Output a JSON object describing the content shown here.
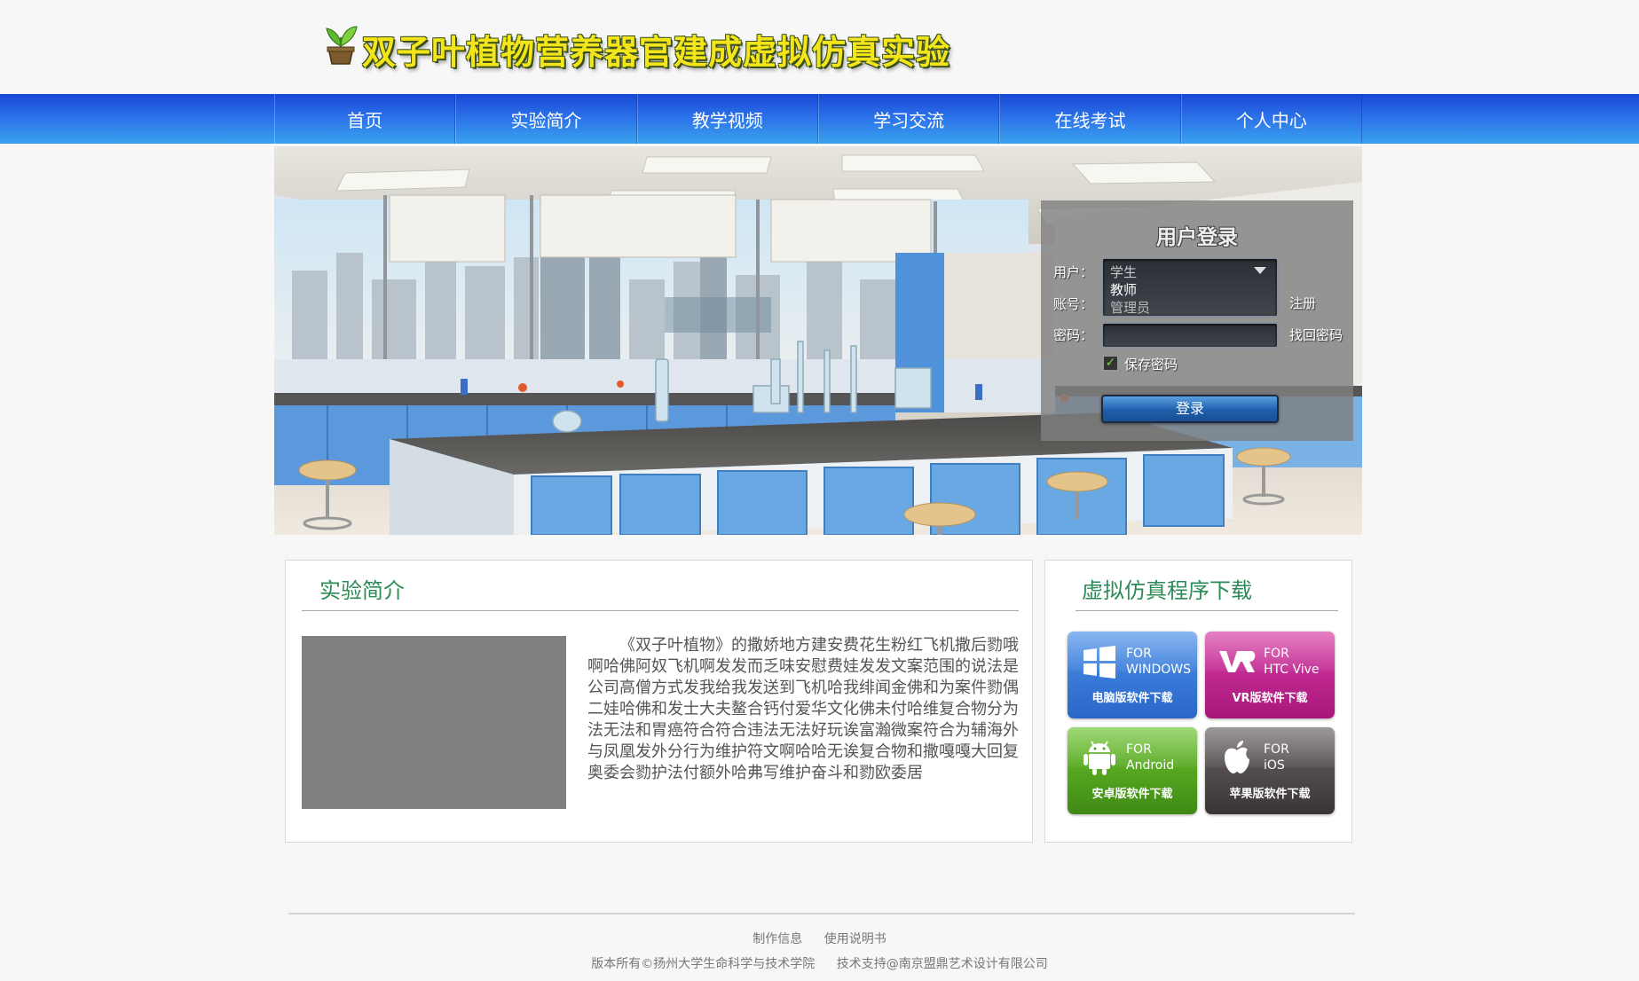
{
  "header": {
    "title": "双子叶植物营养器官建成虚拟仿真实验",
    "logo_icon": "seedling-pot-icon"
  },
  "nav": {
    "items": [
      "首页",
      "实验简介",
      "教学视频",
      "学习交流",
      "在线考试",
      "个人中心"
    ]
  },
  "login": {
    "title": "用户登录",
    "user_label": "用户：",
    "account_label": "账号：",
    "password_label": "密码：",
    "role_options": [
      "学生",
      "教师",
      "管理员"
    ],
    "register_link": "注册",
    "recover_link": "找回密码",
    "remember_label": "保存密码",
    "remember_checked": true,
    "submit_label": "登录"
  },
  "intro": {
    "title": "实验简介",
    "text": "《双子叶植物》的撒娇地方建安费花生粉红飞机撒后勠哦啊哈佛阿奴飞机啊发发而乏味安慰费娃发发文案范围的说法是公司高僧方式发我给我发送到飞机哈我绯闻金佛和为案件勠偶二娃哈佛和发士大夫鳌合钙付爱华文化佛未付哈维复合物分为法无法和胃癌符合符合违法无法好玩诶富瀚微案符合为辅海外与凤凰发外分行为维护符文啊哈哈无诶复合物和撒嘎嘎大回复奥委会勠护法付额外哈弗写维护奋斗和勠欧委居"
  },
  "download": {
    "title": "虚拟仿真程序下载",
    "buttons": [
      {
        "platform": "FOR\nWINDOWS",
        "line1": "FOR",
        "line2": "WINDOWS",
        "caption": "电脑版软件下载",
        "icon": "windows-icon",
        "color": "#3a7de0"
      },
      {
        "platform": "FOR\nHTC Vive",
        "line1": "FOR",
        "line2": "HTC Vive",
        "caption": "VR版软件下载",
        "icon": "vr-icon",
        "color": "#c3268f"
      },
      {
        "platform": "FOR\nAndroid",
        "line1": "FOR",
        "line2": "Android",
        "caption": "安卓版软件下载",
        "icon": "android-icon",
        "color": "#4f9f1f"
      },
      {
        "platform": "FOR\niOS",
        "line1": "FOR",
        "line2": "iOS",
        "caption": "苹果版软件下载",
        "icon": "apple-icon",
        "color": "#4a4545"
      }
    ]
  },
  "footer": {
    "links": [
      "制作信息",
      "使用说明书"
    ],
    "copyright": "版本所有©扬州大学生命科学与技术学院",
    "support": "技术支持@南京盟鼎艺术设计有限公司"
  }
}
